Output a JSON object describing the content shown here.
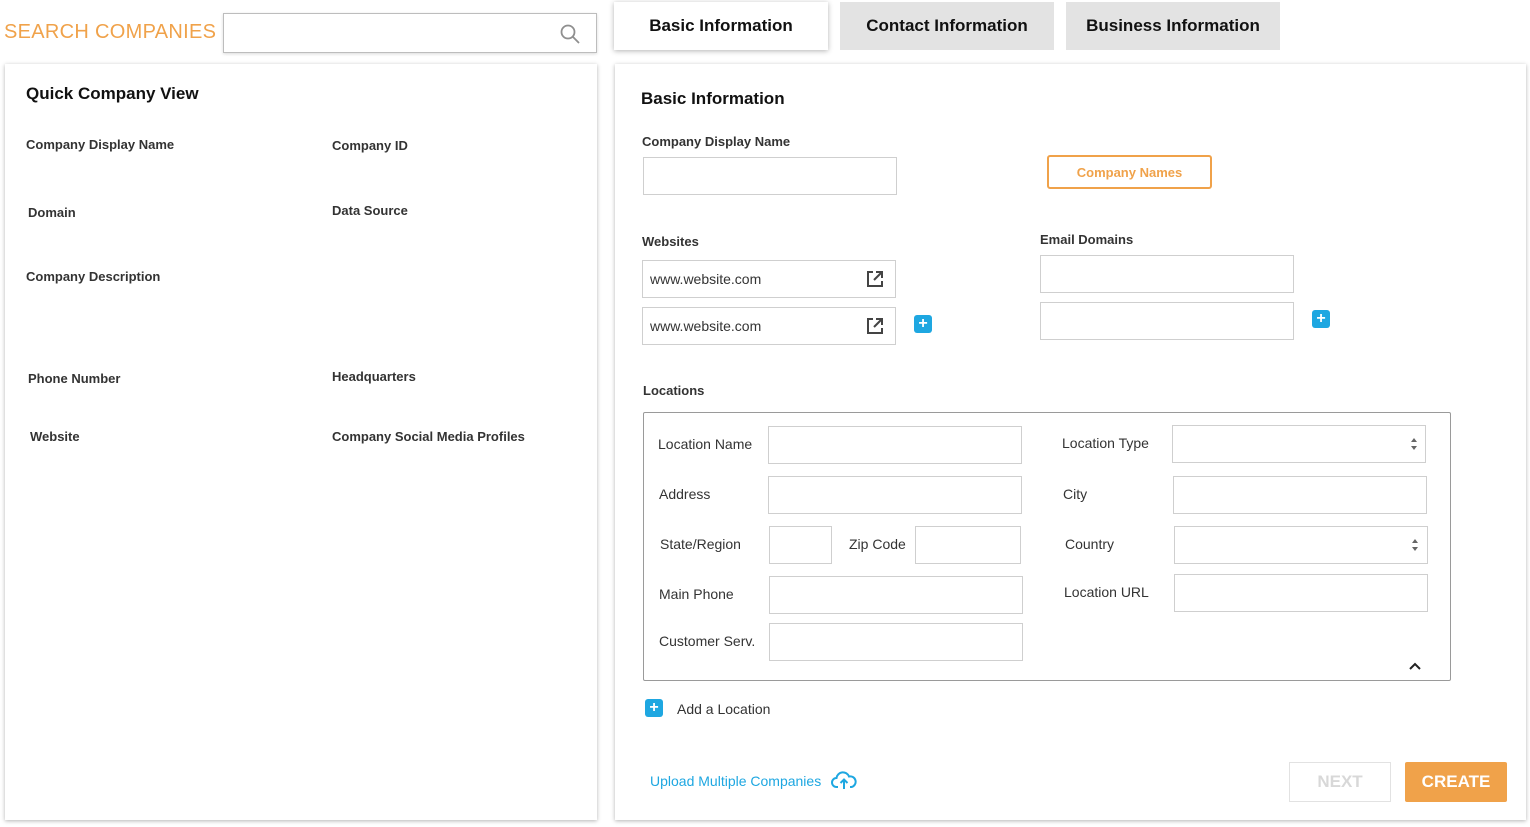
{
  "header": {
    "search_title": "SEARCH COMPANIES",
    "search_value": ""
  },
  "tabs": [
    {
      "label": "Basic Information",
      "active": true
    },
    {
      "label": "Contact Information",
      "active": false
    },
    {
      "label": "Business Information",
      "active": false
    }
  ],
  "quick_view": {
    "title": "Quick Company View",
    "fields": {
      "display_name": "Company Display Name",
      "company_id": "Company ID",
      "domain": "Domain",
      "data_source": "Data Source",
      "description": "Company Description",
      "phone": "Phone Number",
      "headquarters": "Headquarters",
      "website": "Website",
      "social": "Company Social Media Profiles"
    }
  },
  "basic": {
    "title": "Basic Information",
    "display_name_label": "Company Display Name",
    "display_name_value": "",
    "company_names_button": "Company Names",
    "websites_label": "Websites",
    "websites": [
      "www.website.com",
      "www.website.com"
    ],
    "email_domains_label": "Email Domains",
    "email_domains": [
      "",
      ""
    ],
    "locations_label": "Locations",
    "location": {
      "location_name": "Location Name",
      "location_type": "Location Type",
      "address": "Address",
      "city": "City",
      "state_region": "State/Region",
      "zip_code": "Zip Code",
      "country": "Country",
      "main_phone": "Main Phone",
      "location_url": "Location URL",
      "customer_serv": "Customer Serv."
    },
    "add_location": "Add a Location",
    "upload_multiple": "Upload Multiple Companies",
    "next_button": "NEXT",
    "create_button": "CREATE"
  },
  "colors": {
    "accent": "#f0a24a",
    "link": "#1ea7e1",
    "tab_inactive": "#e3e3e3"
  }
}
